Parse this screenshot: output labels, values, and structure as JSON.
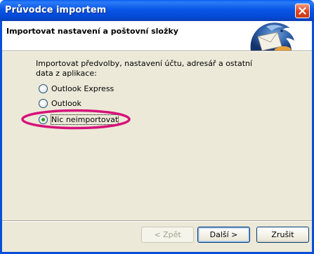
{
  "window": {
    "title": "Průvodce importem",
    "close_symbol": "×"
  },
  "header": {
    "title": "Importovat nastavení a poštovní složky",
    "logo_icon": "thunderbird-logo-icon"
  },
  "main": {
    "description": "Importovat předvolby, nastavení účtu, adresář a ostatní data z aplikace:",
    "options": [
      {
        "label": "Outlook Express",
        "selected": false
      },
      {
        "label": "Outlook",
        "selected": false
      },
      {
        "label": "Nic neimportovat",
        "selected": true
      }
    ],
    "highlight_color": "#d6127a"
  },
  "footer": {
    "back_label": "< Zpět",
    "next_label": "Další >",
    "cancel_label": "Zrušit"
  },
  "colors": {
    "titlebar": "#0a56e6",
    "dialog_bg": "#ece9d8"
  }
}
